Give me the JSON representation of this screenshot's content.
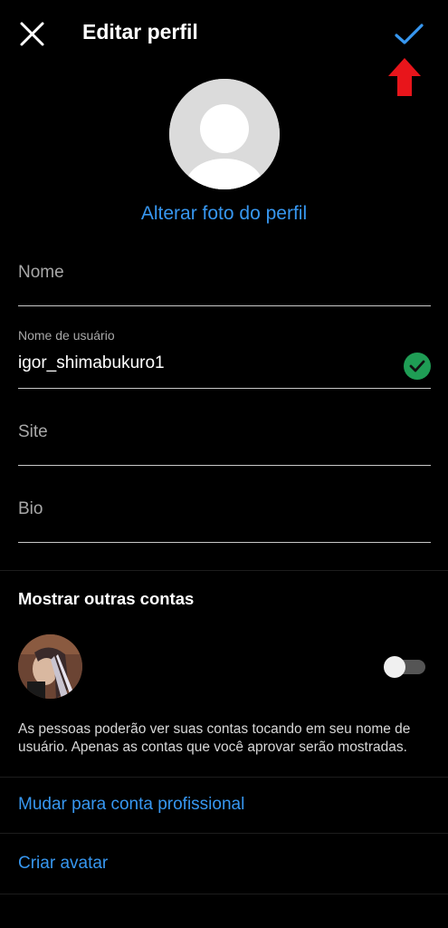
{
  "header": {
    "title": "Editar perfil",
    "close_icon": "close-icon",
    "confirm_icon": "checkmark-icon",
    "annotation": "red-arrow-up-icon",
    "accent_color": "#3797f0",
    "annotation_color": "#e8151b"
  },
  "profile": {
    "change_photo_label": "Alterar foto do perfil"
  },
  "form": {
    "name_placeholder": "Nome",
    "username_label": "Nome de usuário",
    "username_value": "igor_shimabukuro1",
    "username_status_icon": "check-circle-icon",
    "site_placeholder": "Site",
    "bio_placeholder": "Bio"
  },
  "accounts": {
    "section_title": "Mostrar outras contas",
    "account_name": "",
    "toggle_on": false,
    "info_text": "As pessoas poderão ver suas contas tocando em seu nome de usuário. Apenas as contas que você aprovar serão mostradas."
  },
  "links": {
    "professional": "Mudar para conta profissional",
    "avatar": "Criar avatar"
  }
}
